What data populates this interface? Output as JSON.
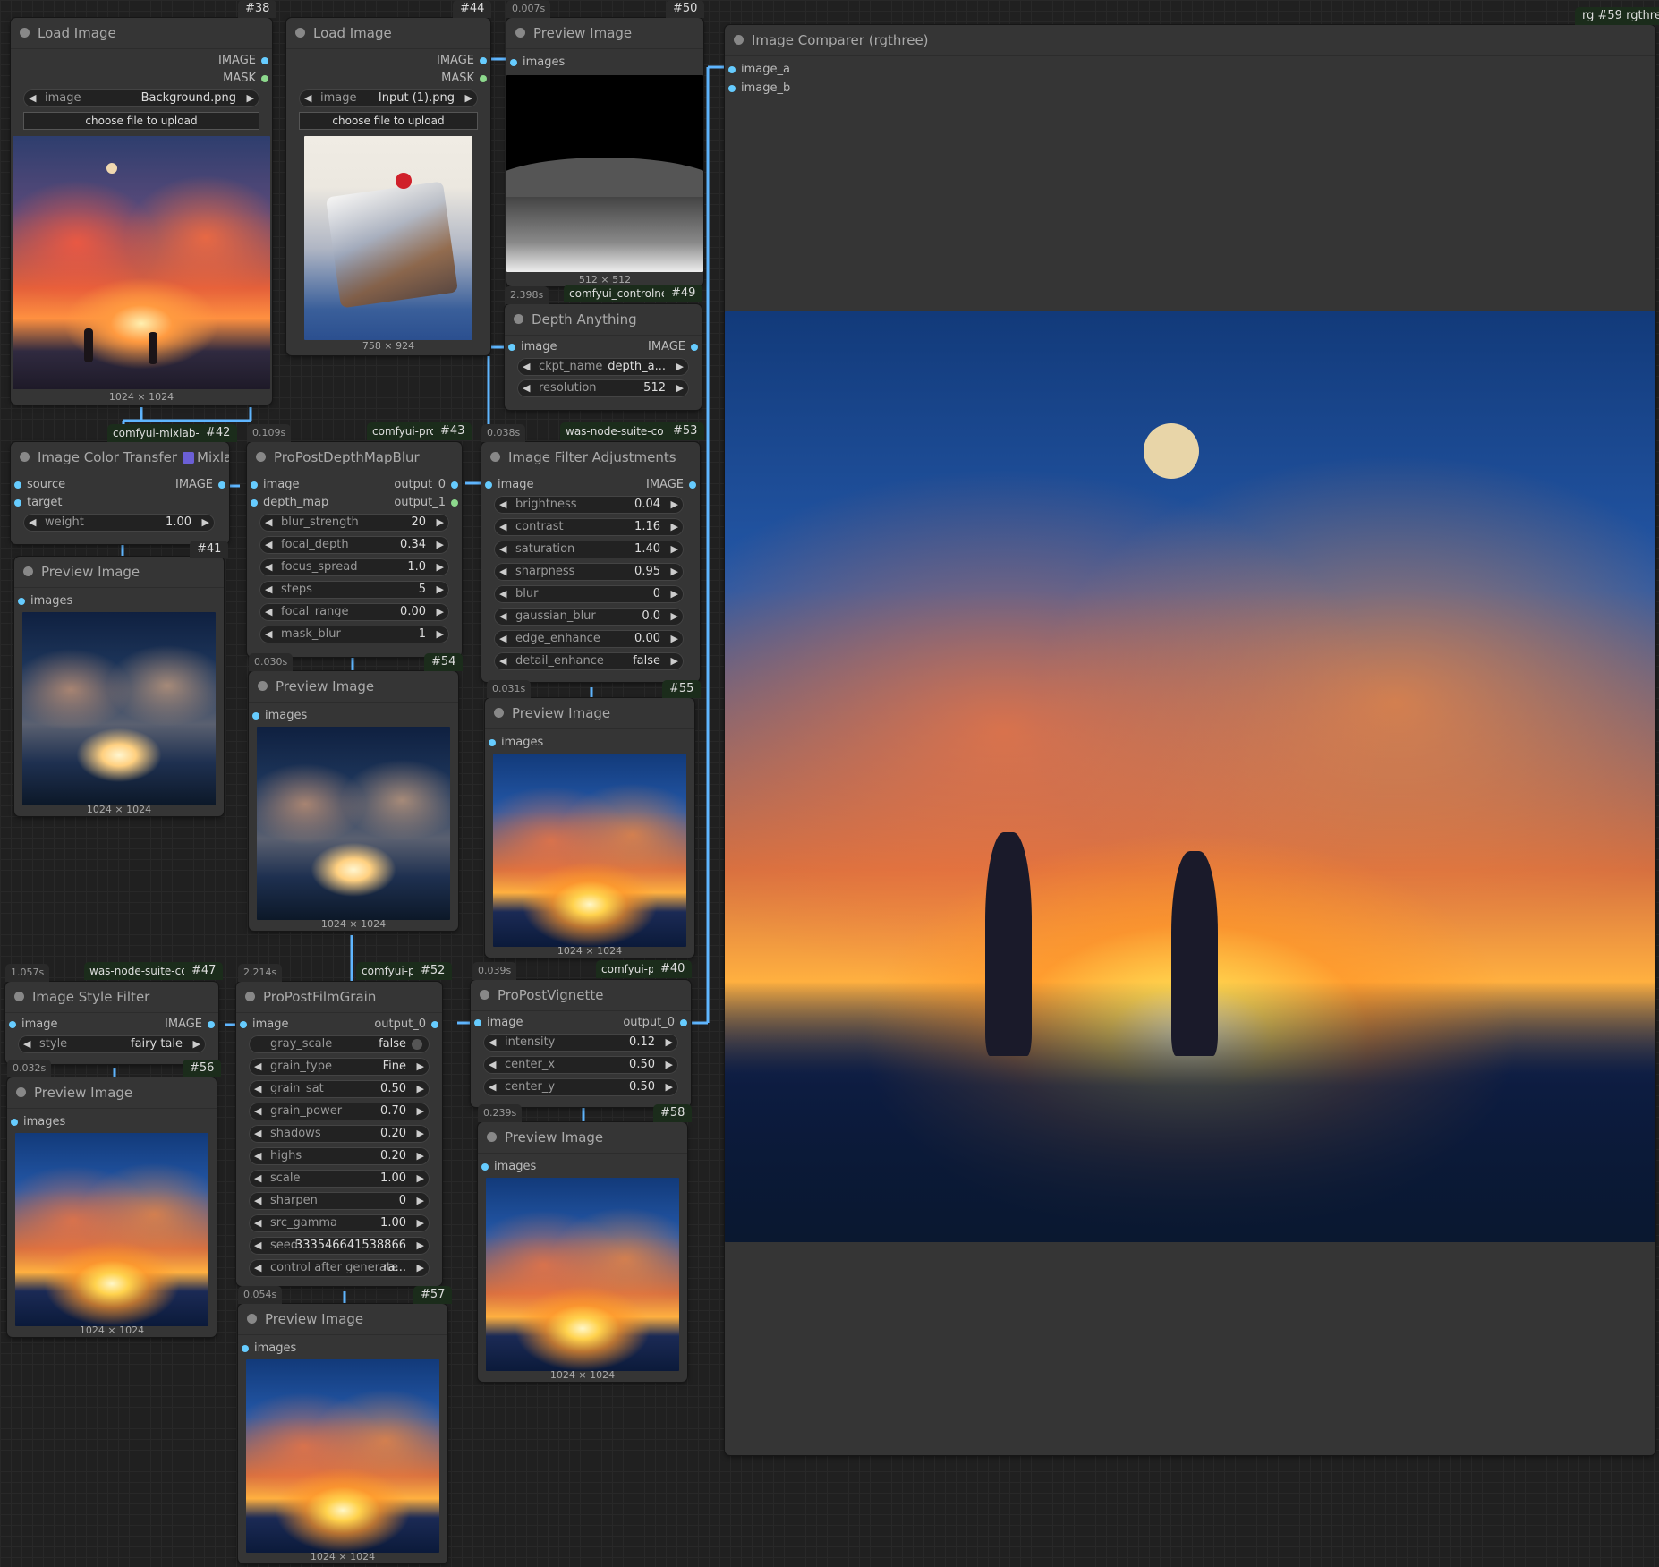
{
  "colors": {
    "link_blue": "#5fb6ff",
    "slot_image": "#66ccff",
    "slot_mask": "#8dd98d",
    "canvas_bg": "#202020",
    "node_bg": "#353535"
  },
  "nodes": {
    "load38": {
      "id": "#38",
      "title": "Load Image",
      "outputs": [
        "IMAGE",
        "MASK"
      ],
      "image_label": "image",
      "image_value": "Background.png",
      "upload_label": "choose file to upload",
      "dim": "1024 × 1024"
    },
    "load44": {
      "id": "#44",
      "title": "Load Image",
      "outputs": [
        "IMAGE",
        "MASK"
      ],
      "image_label": "image",
      "image_value": "Input (1).png",
      "upload_label": "choose file to upload",
      "dim": "758 × 924"
    },
    "prev50": {
      "id": "#50",
      "time": "0.007s",
      "title": "Preview Image",
      "input": "images",
      "dim": "512 × 512"
    },
    "depth49": {
      "id": "#49",
      "time": "2.398s",
      "pack": "comfyui_controlnet",
      "title": "Depth Anything",
      "input": "image",
      "output": "IMAGE",
      "widgets": [
        {
          "label": "ckpt_name",
          "value": "depth_a..."
        },
        {
          "label": "resolution",
          "value": "512"
        }
      ]
    },
    "cmp59": {
      "id": "#59",
      "pack_prefix": "rg",
      "pack": "rgthree",
      "title": "Image Comparer (rgthree)",
      "inputs": [
        "image_a",
        "image_b"
      ]
    },
    "ict42": {
      "id": "#42",
      "pack": "comfyui-mixlab-n",
      "title": "Image Color Transfer",
      "brand": "Mixlab",
      "inputs": [
        "source",
        "target"
      ],
      "output": "IMAGE",
      "widgets": [
        {
          "label": "weight",
          "value": "1.00"
        }
      ]
    },
    "dmb43": {
      "id": "#43",
      "time": "0.109s",
      "pack": "comfyui-pro",
      "title": "ProPostDepthMapBlur",
      "inputs": [
        "image",
        "depth_map"
      ],
      "outputs": [
        "output_0",
        "output_1"
      ],
      "widgets": [
        {
          "label": "blur_strength",
          "value": "20"
        },
        {
          "label": "focal_depth",
          "value": "0.34"
        },
        {
          "label": "focus_spread",
          "value": "1.0"
        },
        {
          "label": "steps",
          "value": "5"
        },
        {
          "label": "focal_range",
          "value": "0.00"
        },
        {
          "label": "mask_blur",
          "value": "1"
        }
      ]
    },
    "ifa53": {
      "id": "#53",
      "time": "0.038s",
      "pack": "was-node-suite-co",
      "title": "Image Filter Adjustments",
      "input": "image",
      "output": "IMAGE",
      "widgets": [
        {
          "label": "brightness",
          "value": "0.04"
        },
        {
          "label": "contrast",
          "value": "1.16"
        },
        {
          "label": "saturation",
          "value": "1.40"
        },
        {
          "label": "sharpness",
          "value": "0.95"
        },
        {
          "label": "blur",
          "value": "0"
        },
        {
          "label": "gaussian_blur",
          "value": "0.0"
        },
        {
          "label": "edge_enhance",
          "value": "0.00"
        },
        {
          "label": "detail_enhance",
          "value": "false"
        }
      ]
    },
    "prev41": {
      "id": "#41",
      "title": "Preview Image",
      "input": "images",
      "dim": "1024 × 1024"
    },
    "prev54": {
      "id": "#54",
      "time": "0.030s",
      "title": "Preview Image",
      "input": "images",
      "dim": "1024 × 1024"
    },
    "prev55": {
      "id": "#55",
      "time": "0.031s",
      "title": "Preview Image",
      "input": "images",
      "dim": "1024 × 1024"
    },
    "isf47": {
      "id": "#47",
      "time": "1.057s",
      "pack": "was-node-suite-co",
      "title": "Image Style Filter",
      "input": "image",
      "output": "IMAGE",
      "widgets": [
        {
          "label": "style",
          "value": "fairy tale"
        }
      ]
    },
    "pfg52": {
      "id": "#52",
      "time": "2.214s",
      "pack": "comfyui-pro",
      "title": "ProPostFilmGrain",
      "input": "image",
      "output": "output_0",
      "widgets": [
        {
          "label": "gray_scale",
          "value": "false"
        },
        {
          "label": "grain_type",
          "value": "Fine"
        },
        {
          "label": "grain_sat",
          "value": "0.50"
        },
        {
          "label": "grain_power",
          "value": "0.70"
        },
        {
          "label": "shadows",
          "value": "0.20"
        },
        {
          "label": "highs",
          "value": "0.20"
        },
        {
          "label": "scale",
          "value": "1.00"
        },
        {
          "label": "sharpen",
          "value": "0"
        },
        {
          "label": "src_gamma",
          "value": "1.00"
        },
        {
          "label": "seed",
          "value": "333546641538866"
        },
        {
          "label": "control after generate",
          "value": "ra..."
        }
      ]
    },
    "ppv40": {
      "id": "#40",
      "time": "0.039s",
      "pack": "comfyui-pro",
      "title": "ProPostVignette",
      "input": "image",
      "output": "output_0",
      "widgets": [
        {
          "label": "intensity",
          "value": "0.12"
        },
        {
          "label": "center_x",
          "value": "0.50"
        },
        {
          "label": "center_y",
          "value": "0.50"
        }
      ]
    },
    "prev56": {
      "id": "#56",
      "time": "0.032s",
      "title": "Preview Image",
      "input": "images",
      "dim": "1024 × 1024"
    },
    "prev58": {
      "id": "#58",
      "time": "0.239s",
      "title": "Preview Image",
      "input": "images",
      "dim": "1024 × 1024"
    },
    "prev57": {
      "id": "#57",
      "time": "0.054s",
      "title": "Preview Image",
      "input": "images",
      "dim": "1024 × 1024"
    }
  }
}
